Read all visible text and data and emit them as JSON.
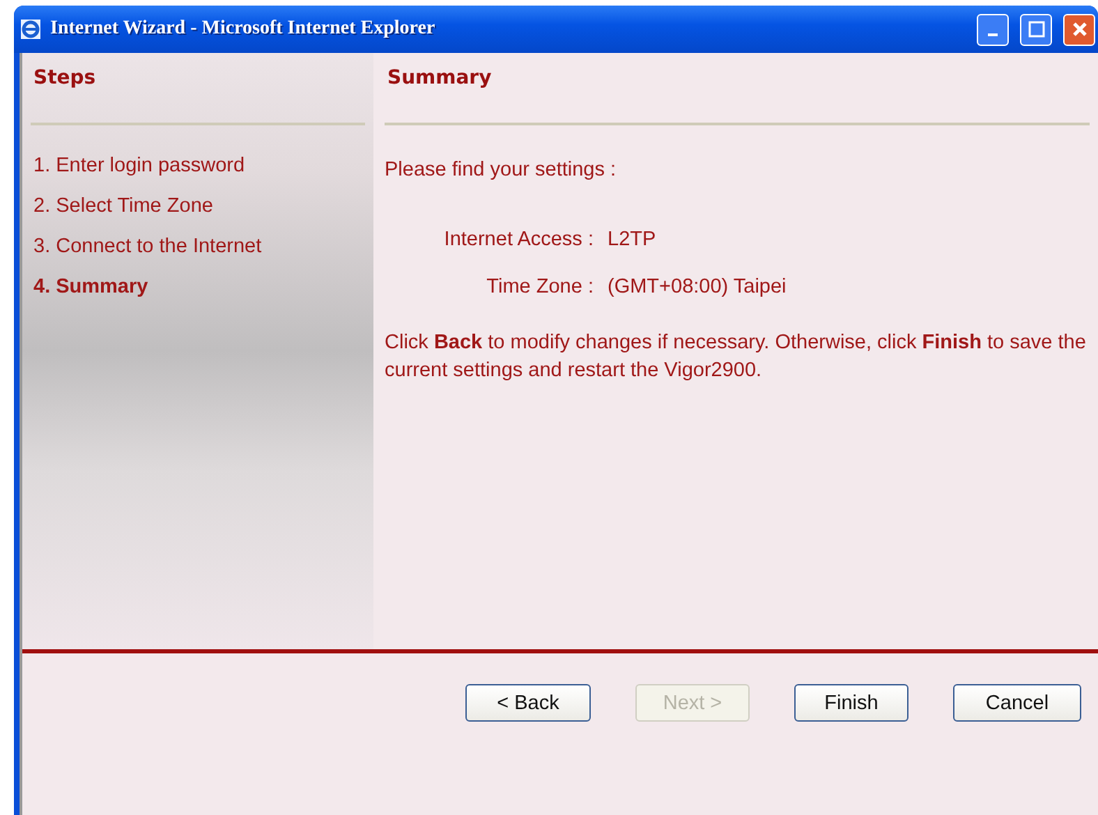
{
  "window": {
    "title": "Internet Wizard - Microsoft Internet Explorer"
  },
  "sidebar": {
    "title": "Steps",
    "items": [
      {
        "label": "1. Enter login password",
        "selected": false
      },
      {
        "label": "2. Select Time Zone",
        "selected": false
      },
      {
        "label": "3. Connect to the Internet",
        "selected": false
      },
      {
        "label": "4. Summary",
        "selected": true
      }
    ]
  },
  "main": {
    "title": "Summary",
    "intro": "Please find your settings :",
    "settings": [
      {
        "label": "Internet Access :",
        "value": "L2TP"
      },
      {
        "label": "Time Zone :",
        "value": "(GMT+08:00) Taipei"
      }
    ],
    "note": "Click **Back** to modify changes if necessary. Otherwise, click **Finish** to save the current settings and restart the Vigor2900."
  },
  "buttons": [
    {
      "label": "< Back",
      "disabled": false
    },
    {
      "label": "Next >",
      "disabled": true
    },
    {
      "label": "Finish",
      "disabled": false
    },
    {
      "label": "Cancel",
      "disabled": false
    }
  ]
}
